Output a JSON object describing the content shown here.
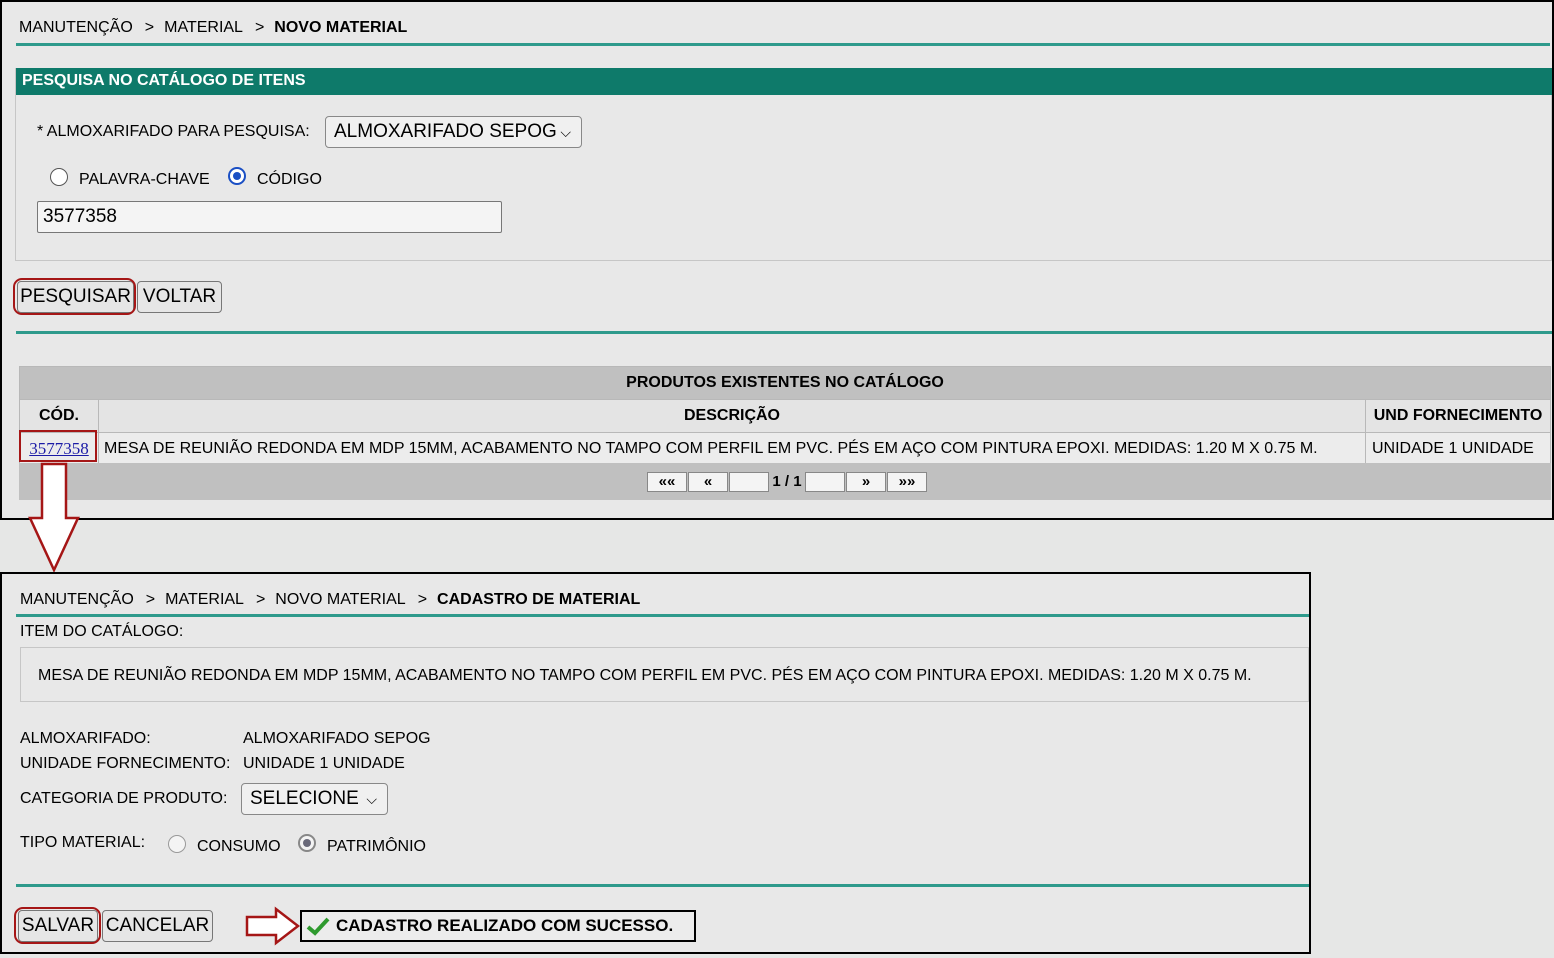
{
  "top": {
    "breadcrumb": [
      "MANUTENÇÃO",
      "MATERIAL",
      "NOVO MATERIAL"
    ],
    "breadcrumb_sep": ">",
    "section_title": "PESQUISA NO CATÁLOGO DE ITENS",
    "almox_label": "* ALMOXARIFADO PARA PESQUISA:",
    "almox_value": "ALMOXARIFADO SEPOG",
    "radio_keyword": "PALAVRA-CHAVE",
    "radio_code": "CÓDIGO",
    "search_value": "3577358",
    "btn_search": "PESQUISAR",
    "btn_back": "VOLTAR",
    "table_title": "PRODUTOS EXISTENTES NO CATÁLOGO",
    "columns": [
      "CÓD.",
      "DESCRIÇÃO",
      "UND FORNECIMENTO"
    ],
    "rows": [
      {
        "code": "3577358",
        "description": "MESA DE REUNIÃO REDONDA EM MDP 15MM, ACABAMENTO NO TAMPO COM PERFIL EM PVC. PÉS EM AÇO COM PINTURA EPOXI. MEDIDAS: 1.20 M X 0.75 M.",
        "unit": "UNIDADE 1 UNIDADE"
      }
    ],
    "pager": {
      "first": "««",
      "prev": "«",
      "page": "1 / 1",
      "next": "»",
      "last": "»»"
    }
  },
  "bottom": {
    "breadcrumb": [
      "MANUTENÇÃO",
      "MATERIAL",
      "NOVO MATERIAL",
      "CADASTRO DE MATERIAL"
    ],
    "item_label": "ITEM DO CATÁLOGO:",
    "item_desc": "MESA DE REUNIÃO REDONDA EM MDP 15MM, ACABAMENTO NO TAMPO COM PERFIL EM PVC. PÉS EM AÇO COM PINTURA EPOXI. MEDIDAS: 1.20 M X 0.75 M.",
    "almox_label": "ALMOXARIFADO:",
    "almox_value": "ALMOXARIFADO SEPOG",
    "unit_label": "UNIDADE FORNECIMENTO:",
    "unit_value": "UNIDADE 1 UNIDADE",
    "category_label": "CATEGORIA DE PRODUTO:",
    "category_value": "SELECIONE",
    "type_label": "TIPO MATERIAL:",
    "type_consumo": "CONSUMO",
    "type_patrimonio": "PATRIMÔNIO",
    "btn_save": "SALVAR",
    "btn_cancel": "CANCELAR",
    "success_msg": "CADASTRO REALIZADO COM SUCESSO."
  },
  "colors": {
    "teal": "#0e7a6a",
    "rule": "#2e9a8c",
    "highlight": "#a51616",
    "check": "#2e9a2e"
  }
}
